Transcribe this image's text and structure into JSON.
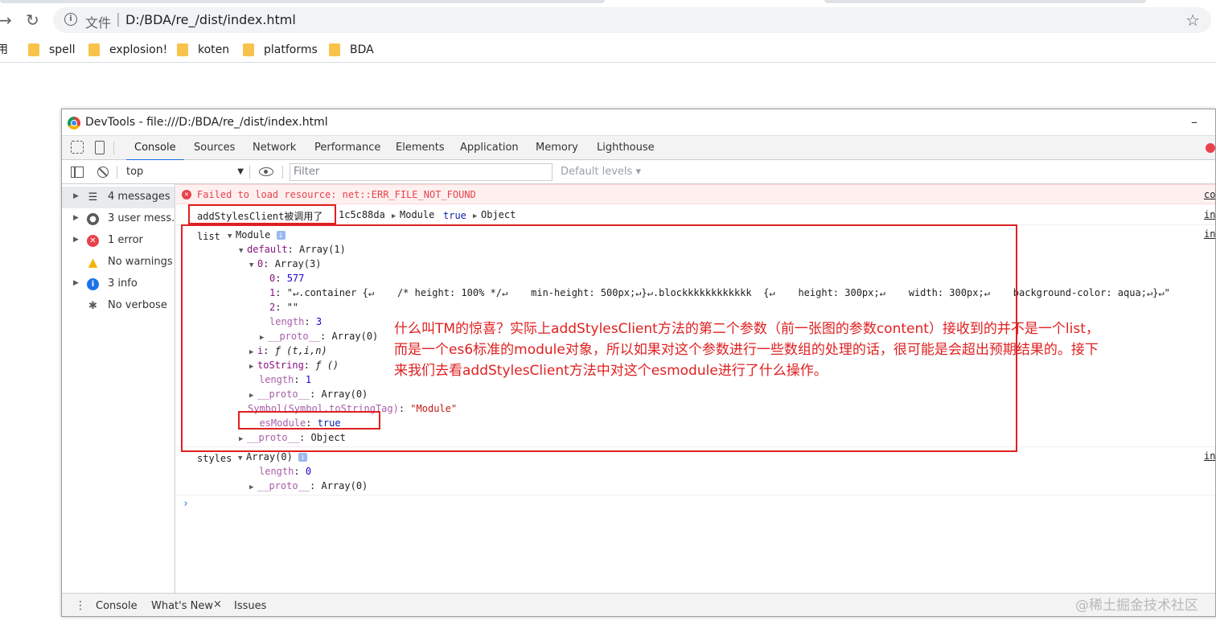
{
  "browser": {
    "address_prefix": "文件",
    "address_sep": "|",
    "url": "D:/BDA/re_/dist/index.html",
    "bookmarks_partial": "用",
    "bookmarks": [
      {
        "label": "spell"
      },
      {
        "label": "explosion!"
      },
      {
        "label": "koten"
      },
      {
        "label": "platforms"
      },
      {
        "label": "BDA"
      }
    ]
  },
  "devtools": {
    "title": "DevTools - file:///D:/BDA/re_/dist/index.html",
    "minimize": "–",
    "tabs": [
      "Console",
      "Sources",
      "Network",
      "Performance",
      "Elements",
      "Application",
      "Memory",
      "Lighthouse"
    ],
    "active_tab": "Console",
    "context": "top",
    "filter_placeholder": "Filter",
    "levels": "Default levels ▾",
    "sidebar": [
      {
        "label": "4 messages",
        "icon": "list-icon",
        "selected": true
      },
      {
        "label": "3 user mess...",
        "icon": "user-icon"
      },
      {
        "label": "1 error",
        "icon": "error-icon"
      },
      {
        "label": "No warnings",
        "icon": "warning-icon"
      },
      {
        "label": "3 info",
        "icon": "info-icon"
      },
      {
        "label": "No verbose",
        "icon": "bug-icon"
      }
    ],
    "log": {
      "error": "Failed to load resource: net::ERR_FILE_NOT_FOUND",
      "error_src": "cor",
      "line1_name": "addStylesClient被调用了",
      "line1_hash": "1c5c88da",
      "line1_module": "Module",
      "line1_true": "true",
      "line1_object": "Object",
      "src": "ind",
      "list_label": "list",
      "module": "Module",
      "default_key": "default",
      "default_val": "Array(1)",
      "zero_key": "0",
      "zero_val": "Array(3)",
      "item0_key": "0",
      "item0_val": "577",
      "item1_key": "1",
      "item1_val": "\"↵.container {↵    /* height: 100% */↵    min-height: 500px;↵}↵.blockkkkkkkkkkkk  {↵    height: 300px;↵    width: 300px;↵    background-color: aqua;↵}↵\"",
      "item2_key": "2",
      "item2_val": "\"\"",
      "length_key": "length",
      "length_val3": "3",
      "proto_key": "__proto__",
      "proto_array0": "Array(0)",
      "i_key": "i",
      "i_val": "ƒ (t,i,n)",
      "tostring_key": "toString",
      "tostring_val": "ƒ ()",
      "length_val1": "1",
      "symbol_key": "Symbol(Symbol.toStringTag)",
      "symbol_val": "\"Module\"",
      "esmodule_key": "__esModule",
      "esmodule_val": "true",
      "proto_object": "Object",
      "styles_label": "styles",
      "styles_val": "Array(0)",
      "length_val0": "0"
    },
    "drawer": {
      "tabs": [
        "Console",
        "What's New",
        "Issues"
      ],
      "close": "×"
    }
  },
  "annotation": {
    "line1": "什么叫TM的惊喜？实际上addStylesClient方法的第二个参数（前一张图的参数content）接收到的并不是一个list，",
    "line2": "而是一个es6标准的module对象，所以如果对这个参数进行一些数组的处理的话，很可能是会超出预期结果的。接下",
    "line3": "来我们去看addStylesClient方法中对这个esmodule进行了什么操作。"
  },
  "watermark": "@稀土掘金技术社区"
}
